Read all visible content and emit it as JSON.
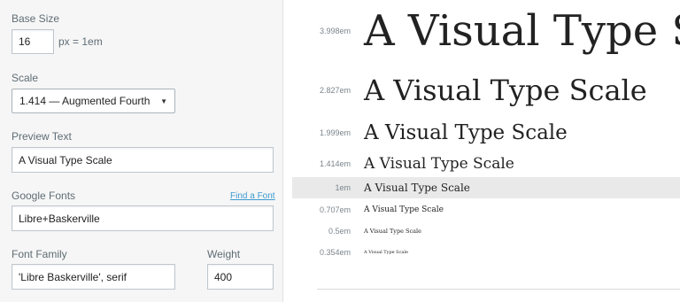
{
  "settings": {
    "base_size": {
      "label": "Base Size",
      "value": "16",
      "unit_note": "px = 1em"
    },
    "scale": {
      "label": "Scale",
      "selected": "1.414 — Augmented Fourth"
    },
    "preview_text": {
      "label": "Preview Text",
      "value": "A Visual Type Scale"
    },
    "google_fonts": {
      "label": "Google Fonts",
      "link": "Find a Font",
      "value": "Libre+Baskerville"
    },
    "font_family": {
      "label": "Font Family",
      "value": "'Libre Baskerville', serif"
    },
    "weight": {
      "label": "Weight",
      "value": "400"
    }
  },
  "scale_rows": [
    {
      "em": "3.998em",
      "text": "A Visual Type Scale",
      "highlighted": false
    },
    {
      "em": "2.827em",
      "text": "A Visual Type Scale",
      "highlighted": false
    },
    {
      "em": "1.999em",
      "text": "A Visual Type Scale",
      "highlighted": false
    },
    {
      "em": "1.414em",
      "text": "A Visual Type Scale",
      "highlighted": false
    },
    {
      "em": "1em",
      "text": "A Visual Type Scale",
      "highlighted": true
    },
    {
      "em": "0.707em",
      "text": "A Visual Type Scale",
      "highlighted": false
    },
    {
      "em": "0.5em",
      "text": "A Visual Type Scale",
      "highlighted": false
    },
    {
      "em": "0.354em",
      "text": "A Visual Type Scale",
      "highlighted": false
    }
  ],
  "colors": {
    "sidebar_bg": "#f6f6f6",
    "label": "#5f6d75",
    "link": "#3d9ad1",
    "highlight_row": "#e9e9e9"
  }
}
